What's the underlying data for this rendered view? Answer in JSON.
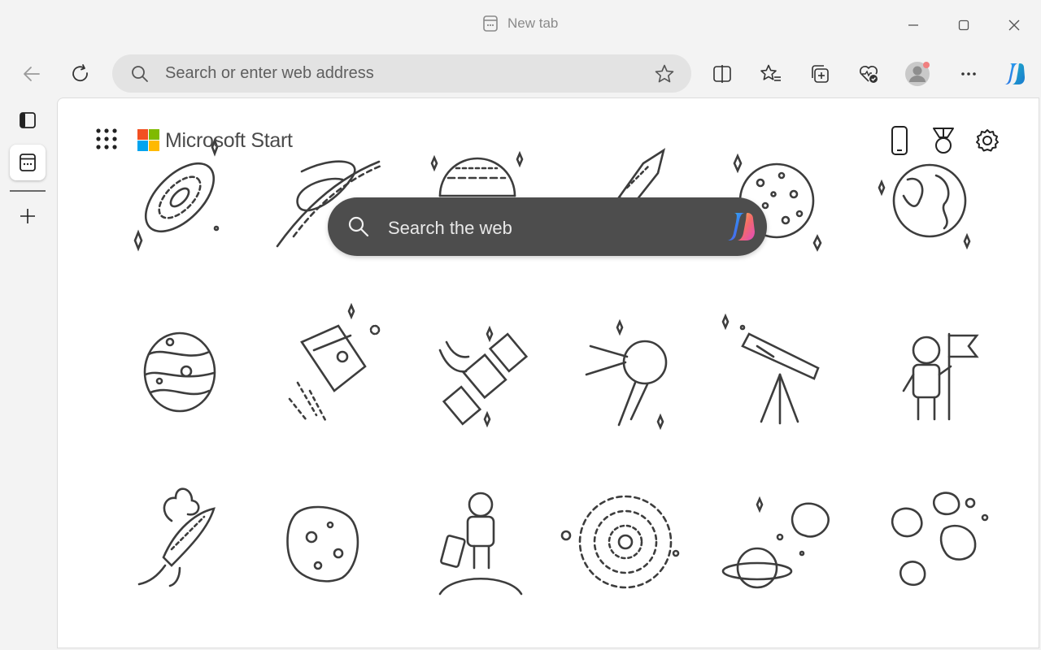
{
  "tab": {
    "title": "New tab"
  },
  "address_bar": {
    "placeholder": "Search or enter web address"
  },
  "header": {
    "brand": "Microsoft Start"
  },
  "search": {
    "placeholder": "Search the web"
  },
  "colors": {
    "chrome_bg": "#f3f3f3",
    "address_bg": "#e3e3e3",
    "search_bg": "#4d4d4d",
    "icon": "#3a3a3a"
  },
  "icons": {
    "window": [
      "minimize-icon",
      "maximize-icon",
      "close-icon"
    ],
    "toolbar": [
      "back-icon",
      "refresh-icon",
      "split-screen-icon",
      "favorites-icon",
      "collections-icon",
      "browser-essentials-icon",
      "profile-icon",
      "more-icon",
      "copilot-icon"
    ],
    "sidebar": [
      "vertical-tabs-icon",
      "tab-icon",
      "new-tab-icon"
    ],
    "page_top_right": [
      "phone-icon",
      "rewards-icon",
      "settings-icon"
    ]
  },
  "background_art": [
    "galaxy",
    "black-hole",
    "planet",
    "rocket",
    "moon",
    "earth",
    "jupiter",
    "space-capsule",
    "satellite",
    "sputnik",
    "telescope",
    "astronaut-with-flag",
    "rocket-launch",
    "asteroid",
    "astronaut-on-planet",
    "solar-system",
    "saturn-and-asteroids",
    "asteroid-field"
  ]
}
